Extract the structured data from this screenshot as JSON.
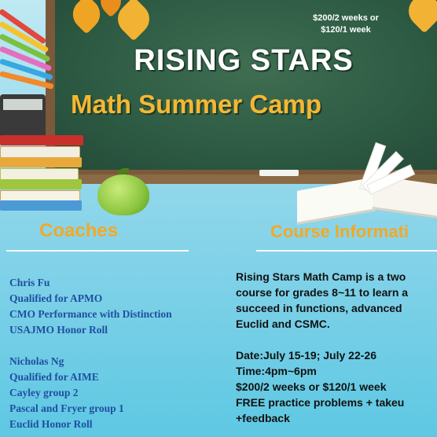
{
  "banner": {
    "price_line1": "$200/2 weeks or",
    "price_line2": "$120/1 week",
    "title_line1": "RISING STARS",
    "title_line2": "Math Summer Camp"
  },
  "coaches": {
    "heading": "Coaches",
    "coach1": {
      "name": "Chris Fu",
      "lines": [
        "Qualified for APMO",
        "CMO Performance with   Distinction",
        "USAJMO Honor Roll"
      ]
    },
    "coach2": {
      "name": "Nicholas Ng",
      "lines": [
        "Qualified for AIME",
        "Cayley group 2",
        "Pascal and Fryer group 1",
        "Euclid Honor Roll"
      ]
    }
  },
  "course": {
    "heading": "Course Informati",
    "desc": [
      "Rising Stars Math Camp is a  two",
      "course for grades 8~11 to learn a",
      "succeed in functions, advanced",
      "Euclid and CSMC."
    ],
    "details": [
      "Date:July 15-19; July 22-26",
      "Time:4pm~6pm",
      "$200/2 weeks or $120/1 week",
      "FREE practice problems + takeu",
      "+feedback"
    ]
  },
  "colors": {
    "heading_orange": "#f3a827",
    "coach_blue": "#1f4fa0",
    "board_green": "#2d5a43"
  }
}
